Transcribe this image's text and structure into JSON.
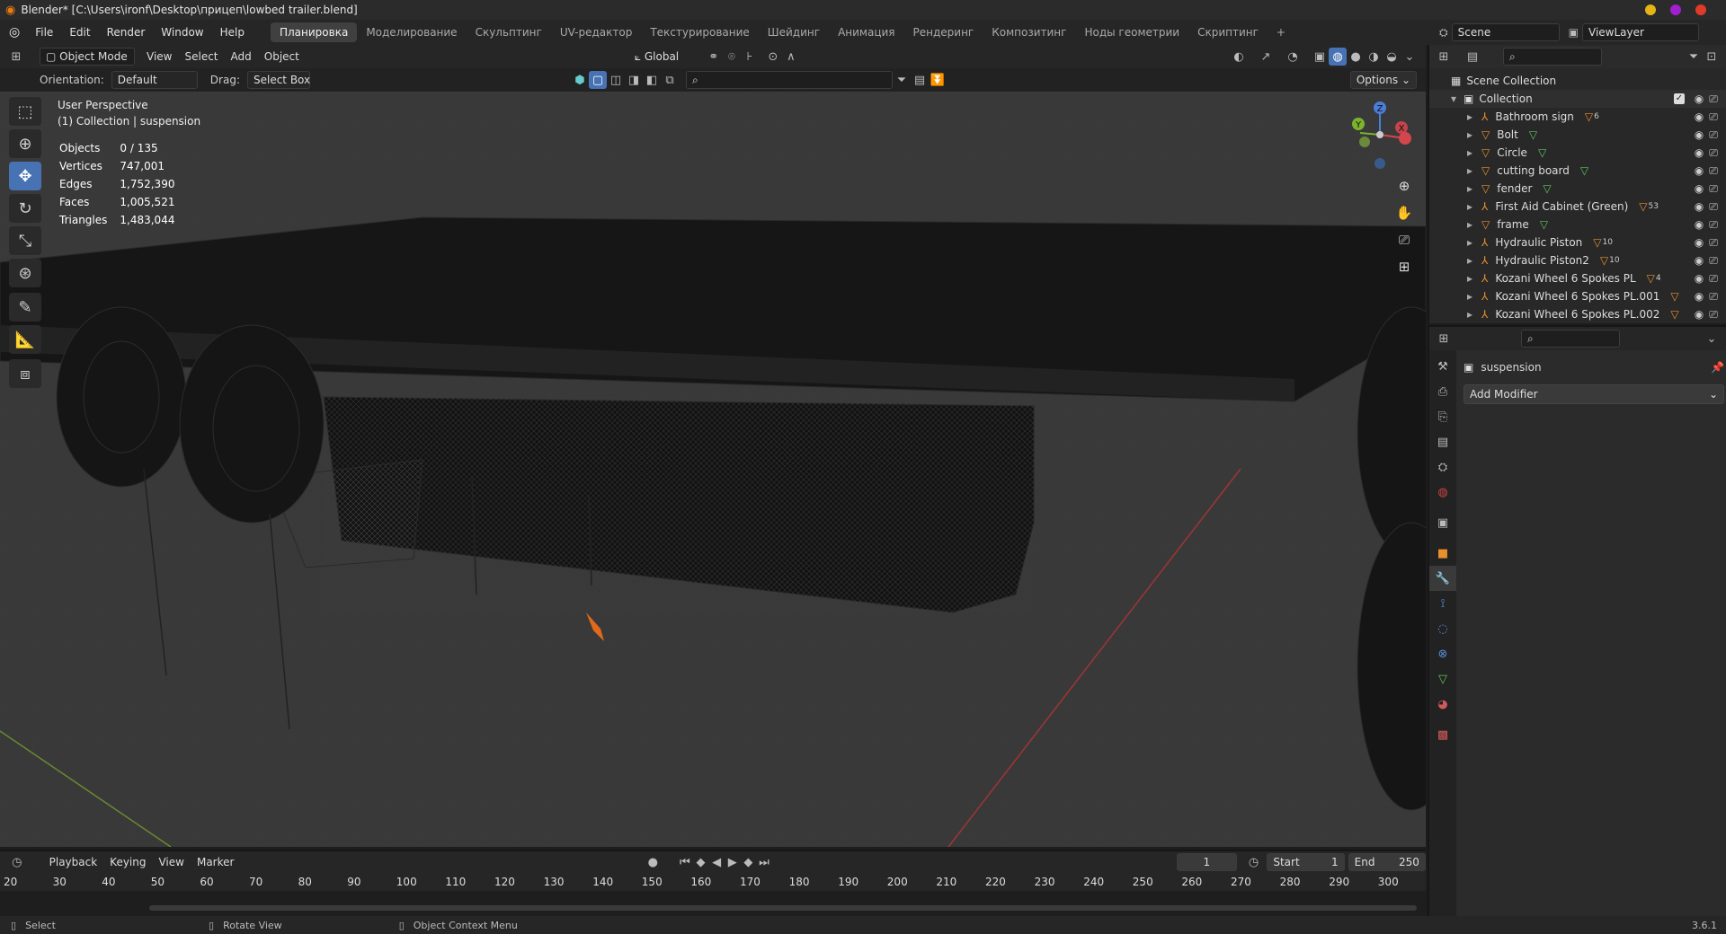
{
  "window": {
    "title": "Blender* [C:\\Users\\ironf\\Desktop\\прицеп\\lowbed trailer.blend]",
    "dots": [
      "#e7b416",
      "#a020d0",
      "#e23a2a"
    ]
  },
  "menu": [
    "File",
    "Edit",
    "Render",
    "Window",
    "Help"
  ],
  "workspaces": [
    "Планировка",
    "Моделирование",
    "Скульптинг",
    "UV-редактор",
    "Текстурирование",
    "Шейдинг",
    "Анимация",
    "Рендеринг",
    "Композитинг",
    "Ноды геометрии",
    "Скриптинг"
  ],
  "scene": {
    "name": "Scene",
    "view_layer": "ViewLayer"
  },
  "viewport_header": {
    "mode": "Object Mode",
    "menus": [
      "View",
      "Select",
      "Add",
      "Object"
    ],
    "transform": "Global",
    "options": "Options"
  },
  "tool_header": {
    "orientation_label": "Orientation:",
    "orientation_value": "Default",
    "drag_label": "Drag:",
    "drag_value": "Select Box"
  },
  "overlay": {
    "perspective": "User Perspective",
    "collection": "(1) Collection | suspension"
  },
  "stats": [
    {
      "label": "Objects",
      "value": "0 / 135"
    },
    {
      "label": "Vertices",
      "value": "747,001"
    },
    {
      "label": "Edges",
      "value": "1,752,390"
    },
    {
      "label": "Faces",
      "value": "1,005,521"
    },
    {
      "label": "Triangles",
      "value": "1,483,044"
    }
  ],
  "gizmo": {
    "x": "X",
    "y": "Y",
    "z": "Z"
  },
  "outliner": {
    "root": "Scene Collection",
    "collection": "Collection",
    "items": [
      {
        "name": "Bathroom sign",
        "type": "armature",
        "extra": "6"
      },
      {
        "name": "Bolt",
        "type": "mesh",
        "extra": ""
      },
      {
        "name": "Circle",
        "type": "mesh",
        "extra": ""
      },
      {
        "name": "cutting board",
        "type": "mesh",
        "extra": ""
      },
      {
        "name": "fender",
        "type": "mesh",
        "extra": ""
      },
      {
        "name": "First Aid Cabinet (Green)",
        "type": "armature",
        "extra": "53"
      },
      {
        "name": "frame",
        "type": "mesh",
        "extra": ""
      },
      {
        "name": "Hydraulic Piston",
        "type": "armature",
        "extra": "10"
      },
      {
        "name": "Hydraulic Piston2",
        "type": "armature",
        "extra": "10"
      },
      {
        "name": "Kozani Wheel 6 Spokes PL",
        "type": "armature",
        "extra": "4"
      },
      {
        "name": "Kozani Wheel 6 Spokes PL.001",
        "type": "armature",
        "extra": ""
      },
      {
        "name": "Kozani Wheel 6 Spokes PL.002",
        "type": "armature",
        "extra": ""
      }
    ]
  },
  "properties": {
    "object": "suspension",
    "add_modifier": "Add Modifier"
  },
  "timeline": {
    "menus": [
      "Playback",
      "Keying",
      "View",
      "Marker"
    ],
    "frame": "1",
    "start_label": "Start",
    "start": "1",
    "end_label": "End",
    "end": "250",
    "ticks": [
      "20",
      "30",
      "40",
      "50",
      "60",
      "70",
      "80",
      "90",
      "100",
      "110",
      "120",
      "130",
      "140",
      "150",
      "160",
      "170",
      "180",
      "190",
      "200",
      "210",
      "220",
      "230",
      "240",
      "250",
      "260",
      "270",
      "280",
      "290",
      "300"
    ]
  },
  "status": {
    "select": "Select",
    "rotate": "Rotate View",
    "context": "Object Context Menu",
    "version": "3.6.1"
  }
}
